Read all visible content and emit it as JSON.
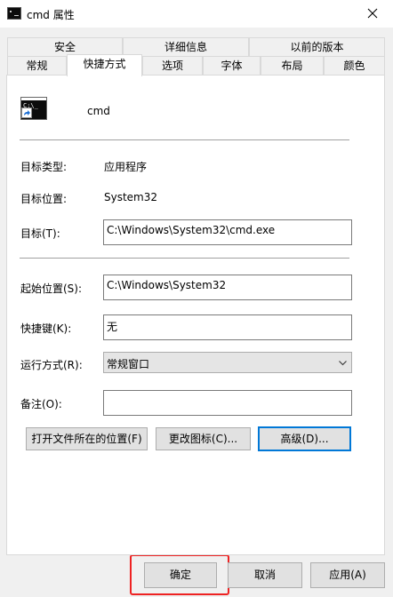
{
  "window": {
    "title": "cmd 属性"
  },
  "tabs": {
    "row1": [
      "安全",
      "详细信息",
      "以前的版本"
    ],
    "row2": [
      "常规",
      "快捷方式",
      "选项",
      "字体",
      "布局",
      "颜色"
    ],
    "active": "快捷方式"
  },
  "shortcut": {
    "name": "cmd",
    "target_type_label": "目标类型:",
    "target_type_value": "应用程序",
    "target_location_label": "目标位置:",
    "target_location_value": "System32",
    "target_label": "目标(T):",
    "target_value": "C:\\Windows\\System32\\cmd.exe",
    "start_in_label": "起始位置(S):",
    "start_in_value": "C:\\Windows\\System32",
    "hotkey_label": "快捷键(K):",
    "hotkey_value": "无",
    "run_label": "运行方式(R):",
    "run_value": "常规窗口",
    "comment_label": "备注(O):",
    "comment_value": ""
  },
  "buttons": {
    "open_location": "打开文件所在的位置(F)",
    "change_icon": "更改图标(C)...",
    "advanced": "高级(D)...",
    "ok": "确定",
    "cancel": "取消",
    "apply": "应用(A)"
  },
  "icons": {
    "app": "console-icon",
    "close": "close-icon",
    "dropdown": "chevron-down-icon",
    "shortcut_overlay": "shortcut-arrow-icon"
  },
  "colors": {
    "focus_border": "#0078d7",
    "annotation_highlight": "#e22222"
  }
}
